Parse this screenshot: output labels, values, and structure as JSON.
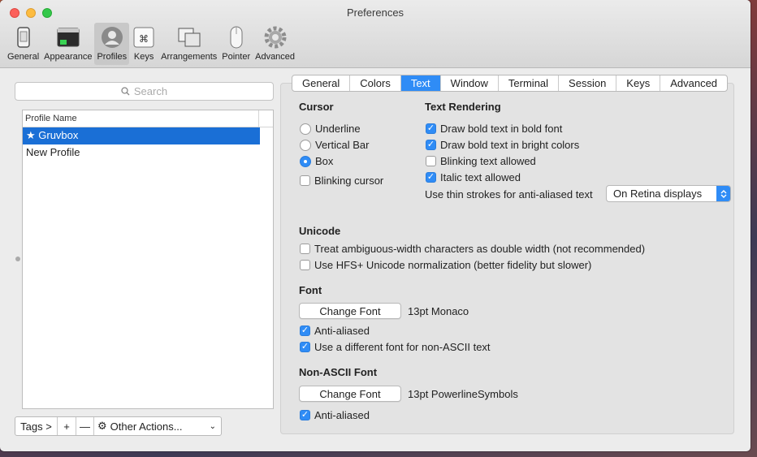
{
  "window": {
    "title": "Preferences"
  },
  "toolbar": {
    "items": [
      {
        "label": "General",
        "icon": "phone-icon"
      },
      {
        "label": "Appearance",
        "icon": "terminal-window-icon"
      },
      {
        "label": "Profiles",
        "icon": "person-icon"
      },
      {
        "label": "Keys",
        "icon": "command-key-icon"
      },
      {
        "label": "Arrangements",
        "icon": "window-layout-icon"
      },
      {
        "label": "Pointer",
        "icon": "mouse-icon"
      },
      {
        "label": "Advanced",
        "icon": "gear-icon"
      }
    ]
  },
  "profiles": {
    "search_placeholder": "Search",
    "column_header": "Profile Name",
    "items": [
      "★ Gruvbox",
      "New Profile"
    ],
    "tags_label": "Tags >",
    "add_label": "+",
    "remove_label": "—",
    "other_actions_label": "Other Actions..."
  },
  "tabs": [
    "General",
    "Colors",
    "Text",
    "Window",
    "Terminal",
    "Session",
    "Keys",
    "Advanced"
  ],
  "cursor": {
    "title": "Cursor",
    "options": [
      "Underline",
      "Vertical Bar",
      "Box"
    ],
    "blinking_label": "Blinking cursor"
  },
  "text_rendering": {
    "title": "Text Rendering",
    "options": [
      "Draw bold text in bold font",
      "Draw bold text in bright colors",
      "Blinking text allowed",
      "Italic text allowed"
    ],
    "thin_strokes_label": "Use thin strokes for anti-aliased text",
    "thin_strokes_value": "On Retina displays"
  },
  "unicode": {
    "title": "Unicode",
    "options": [
      "Treat ambiguous-width characters as double width (not recommended)",
      "Use HFS+ Unicode normalization (better fidelity but slower)"
    ]
  },
  "font": {
    "title": "Font",
    "change_label": "Change Font",
    "current": "13pt Monaco",
    "anti_aliased_label": "Anti-aliased",
    "non_ascii_label": "Use a different font for non-ASCII text"
  },
  "non_ascii_font": {
    "title": "Non-ASCII Font",
    "change_label": "Change Font",
    "current": "13pt PowerlineSymbols",
    "anti_aliased_label": "Anti-aliased"
  },
  "colors": {
    "accent": "#2f8cf6",
    "selection": "#1a6fd6"
  }
}
